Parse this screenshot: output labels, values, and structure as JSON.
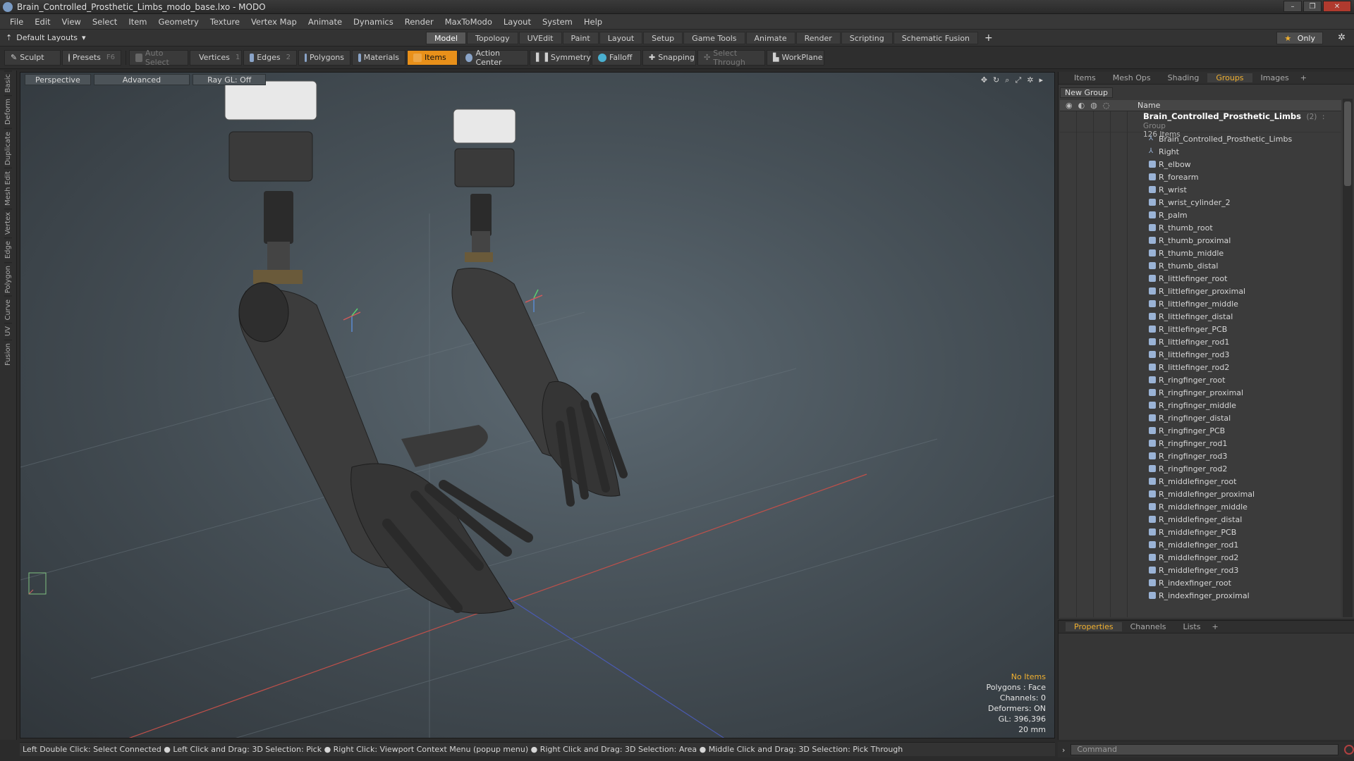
{
  "window": {
    "title": "Brain_Controlled_Prosthetic_Limbs_modo_base.lxo - MODO"
  },
  "menu": [
    "File",
    "Edit",
    "View",
    "Select",
    "Item",
    "Geometry",
    "Texture",
    "Vertex Map",
    "Animate",
    "Dynamics",
    "Render",
    "MaxToModo",
    "Layout",
    "System",
    "Help"
  ],
  "layout": {
    "select_label": "Default Layouts",
    "tabs": [
      "Model",
      "Topology",
      "UVEdit",
      "Paint",
      "Layout",
      "Setup",
      "Game Tools",
      "Animate",
      "Render",
      "Scripting",
      "Schematic Fusion"
    ],
    "active_tab": "Model",
    "only_label": "Only"
  },
  "toolbar": {
    "sculpt": "Sculpt",
    "presets": "Presets",
    "presets_key": "F6",
    "auto_select": "Auto Select",
    "vertices": "Vertices",
    "vertices_key": "1",
    "edges": "Edges",
    "edges_key": "2",
    "polygons": "Polygons",
    "materials": "Materials",
    "items": "Items",
    "action_center": "Action Center",
    "symmetry": "Symmetry",
    "falloff": "Falloff",
    "snapping": "Snapping",
    "select_through": "Select Through",
    "workplane": "WorkPlane"
  },
  "left_tabs": [
    "Basic",
    "Deform",
    "Duplicate",
    "Mesh Edit",
    "Vertex",
    "Edge",
    "Polygon",
    "Curve",
    "UV",
    "Fusion"
  ],
  "viewport": {
    "perspective": "Perspective",
    "advanced": "Advanced",
    "raygl": "Ray GL: Off",
    "info": {
      "items": "No Items",
      "polygons": "Polygons : Face",
      "channels": "Channels: 0",
      "deformers": "Deformers: ON",
      "gl": "GL: 396,396",
      "scale": "20 mm"
    }
  },
  "status_bar": "Left Double Click: Select Connected ● Left Click and Drag: 3D Selection: Pick ● Right Click: Viewport Context Menu (popup menu) ● Right Click and Drag: 3D Selection: Area ● Middle Click and Drag: 3D Selection: Pick Through",
  "right_panel": {
    "tabs": [
      "Items",
      "Mesh Ops",
      "Shading",
      "Groups",
      "Images"
    ],
    "active_tab": "Groups",
    "new_group": "New Group",
    "name_header": "Name",
    "group": {
      "name": "Brain_Controlled_Prosthetic_Limbs",
      "count": "(2)",
      "type": ": Group",
      "subtitle": "126 Items"
    },
    "items": [
      "Brain_Controlled_Prosthetic_Limbs",
      "Right",
      "R_elbow",
      "R_forearm",
      "R_wrist",
      "R_wrist_cylinder_2",
      "R_palm",
      "R_thumb_root",
      "R_thumb_proximal",
      "R_thumb_middle",
      "R_thumb_distal",
      "R_littlefinger_root",
      "R_littlefinger_proximal",
      "R_littlefinger_middle",
      "R_littlefinger_distal",
      "R_littlefinger_PCB",
      "R_littlefinger_rod1",
      "R_littlefinger_rod3",
      "R_littlefinger_rod2",
      "R_ringfinger_root",
      "R_ringfinger_proximal",
      "R_ringfinger_middle",
      "R_ringfinger_distal",
      "R_ringfinger_PCB",
      "R_ringfinger_rod1",
      "R_ringfinger_rod3",
      "R_ringfinger_rod2",
      "R_middlefinger_root",
      "R_middlefinger_proximal",
      "R_middlefinger_middle",
      "R_middlefinger_distal",
      "R_middlefinger_PCB",
      "R_middlefinger_rod1",
      "R_middlefinger_rod2",
      "R_middlefinger_rod3",
      "R_indexfinger_root",
      "R_indexfinger_proximal"
    ]
  },
  "props_panel": {
    "tabs": [
      "Properties",
      "Channels",
      "Lists"
    ],
    "active_tab": "Properties"
  },
  "command": {
    "placeholder": "Command"
  },
  "colors": {
    "accent": "#e8901a",
    "tab_active_text": "#f0b030"
  }
}
